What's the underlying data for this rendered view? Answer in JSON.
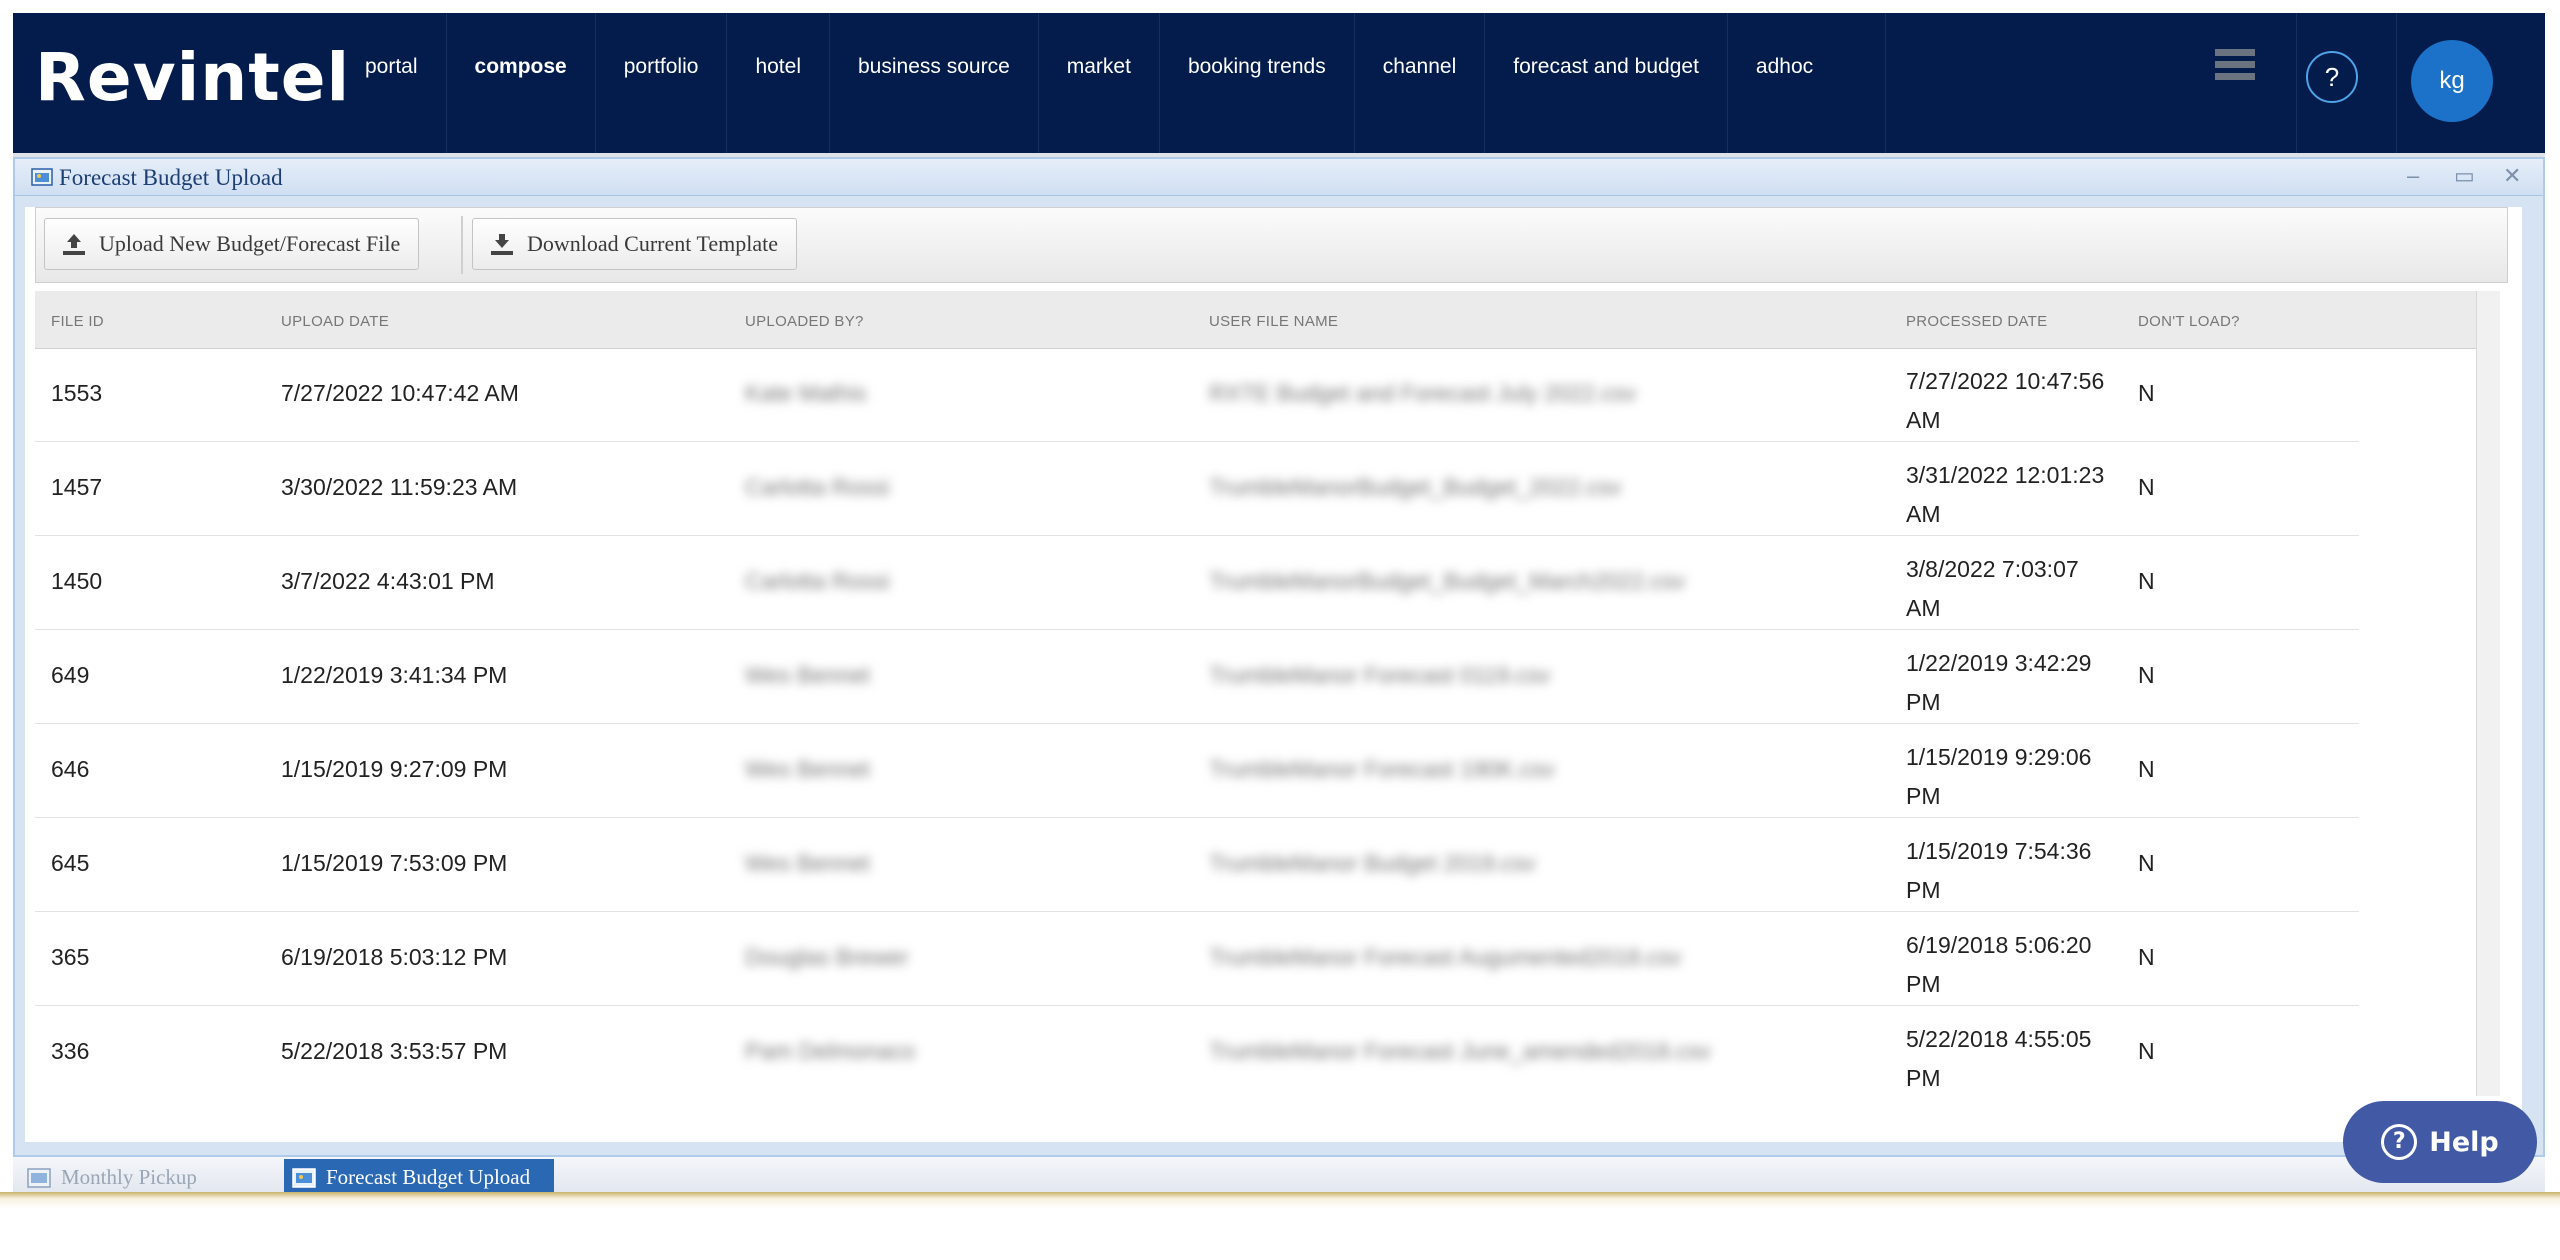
{
  "brand": "Revintel",
  "nav": {
    "items": [
      "portal",
      "compose",
      "portfolio",
      "hotel",
      "business source",
      "market",
      "booking trends",
      "channel",
      "forecast and budget",
      "adhoc"
    ],
    "active": "compose",
    "help_symbol": "?",
    "user_initials": "kg"
  },
  "window": {
    "title": "Forecast Budget Upload",
    "controls": {
      "minimize": "–",
      "maximize": "▭",
      "close": "✕"
    }
  },
  "toolbar": {
    "upload_label": "Upload New Budget/Forecast File",
    "download_label": "Download Current Template"
  },
  "grid": {
    "columns": [
      "FILE ID",
      "UPLOAD DATE",
      "UPLOADED BY?",
      "USER FILE NAME",
      "PROCESSED DATE",
      "DON'T LOAD?"
    ],
    "rows": [
      {
        "file_id": "1553",
        "upload_date": "7/27/2022 10:47:42 AM",
        "uploaded_by": "Kate Mathis",
        "file_name": "RXTE Budget and Forecast July 2022.csv",
        "processed_date": "7/27/2022 10:47:56 AM",
        "dont_load": "N"
      },
      {
        "file_id": "1457",
        "upload_date": "3/30/2022 11:59:23 AM",
        "uploaded_by": "Carlotta Rossi",
        "file_name": "TrumbleManorBudget_Budget_2022.csv",
        "processed_date": "3/31/2022 12:01:23 AM",
        "dont_load": "N"
      },
      {
        "file_id": "1450",
        "upload_date": "3/7/2022 4:43:01 PM",
        "uploaded_by": "Carlotta Rossi",
        "file_name": "TrumbleManorBudget_Budget_March2022.csv",
        "processed_date": "3/8/2022 7:03:07 AM",
        "dont_load": "N"
      },
      {
        "file_id": "649",
        "upload_date": "1/22/2019 3:41:34 PM",
        "uploaded_by": "Wes Bennet",
        "file_name": "TrumbleManor Forecast 0119.csv",
        "processed_date": "1/22/2019 3:42:29 PM",
        "dont_load": "N"
      },
      {
        "file_id": "646",
        "upload_date": "1/15/2019 9:27:09 PM",
        "uploaded_by": "Wes Bennet",
        "file_name": "TrumbleManor Forecast 190K.csv",
        "processed_date": "1/15/2019 9:29:06 PM",
        "dont_load": "N"
      },
      {
        "file_id": "645",
        "upload_date": "1/15/2019 7:53:09 PM",
        "uploaded_by": "Wes Bennet",
        "file_name": "TrumbleManor Budget 2019.csv",
        "processed_date": "1/15/2019 7:54:36 PM",
        "dont_load": "N"
      },
      {
        "file_id": "365",
        "upload_date": "6/19/2018 5:03:12 PM",
        "uploaded_by": "Douglas Brewer",
        "file_name": "TrumbleManor Forecast Augumented2018.csv",
        "processed_date": "6/19/2018 5:06:20 PM",
        "dont_load": "N"
      },
      {
        "file_id": "336",
        "upload_date": "5/22/2018 3:53:57 PM",
        "uploaded_by": "Pam Delmonaco",
        "file_name": "TrumbleManor Forecast June_amended2018.csv",
        "processed_date": "5/22/2018 4:55:05 PM",
        "dont_load": "N"
      }
    ]
  },
  "taskbar": {
    "items": [
      "Monthly Pickup",
      "Forecast Budget Upload"
    ],
    "active": "Forecast Budget Upload"
  },
  "help_button": "Help",
  "colors": {
    "navbar": "#041c4b",
    "avatar": "#1b72c8",
    "task_active": "#2a68b3",
    "help_pill": "#4259a6"
  }
}
